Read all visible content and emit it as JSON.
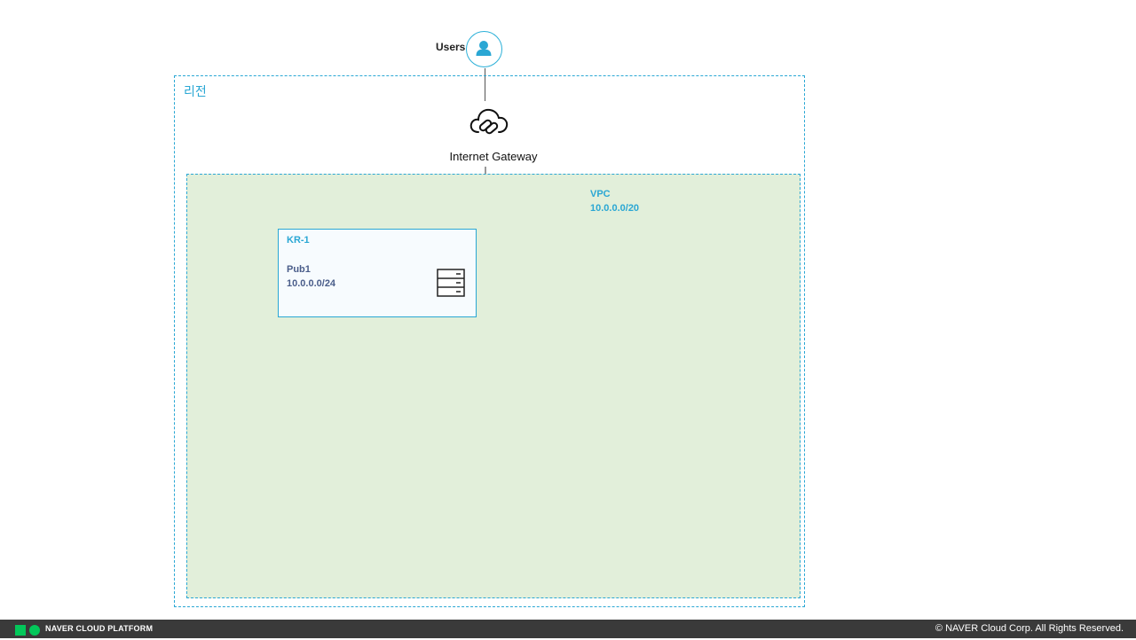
{
  "diagram": {
    "users": {
      "label": "Users",
      "icon": "user-icon"
    },
    "region": {
      "label": "리전"
    },
    "gateway": {
      "label": "Internet Gateway",
      "icon": "cloud-link-icon"
    },
    "vpc": {
      "name": "VPC",
      "cidr": "10.0.0.0/20"
    },
    "subnet": {
      "zone": "KR-1",
      "name": "Pub1",
      "cidr": "10.0.0.0/24",
      "icon": "server-icon"
    }
  },
  "footer": {
    "brand": "NAVER CLOUD PLATFORM",
    "copyright": "© NAVER Cloud Corp. All Rights Reserved."
  },
  "colors": {
    "accent": "#2aa7d4",
    "vpc_fill": "#e2efda",
    "footer_bg": "#3a3a3a",
    "brand_green": "#03c75a"
  }
}
